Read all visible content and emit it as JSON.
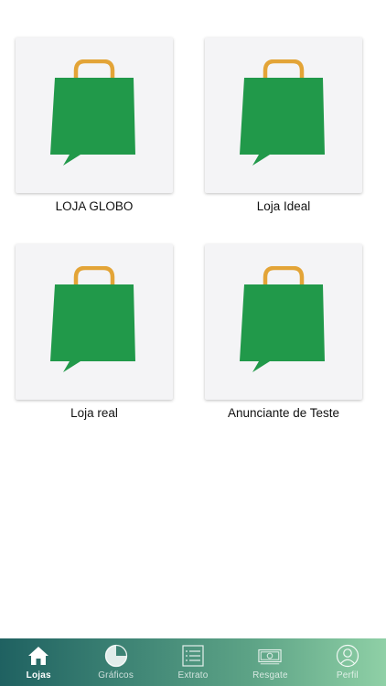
{
  "stores": [
    {
      "name": "LOJA GLOBO",
      "icon": "shopping-bag-chat-icon"
    },
    {
      "name": "Loja Ideal",
      "icon": "shopping-bag-chat-icon"
    },
    {
      "name": "Loja real",
      "icon": "shopping-bag-chat-icon"
    },
    {
      "name": "Anunciante de Teste",
      "icon": "shopping-bag-chat-icon"
    }
  ],
  "tabbar": {
    "active": "Lojas",
    "tabs": [
      {
        "label": "Lojas",
        "icon": "home-icon"
      },
      {
        "label": "Gráficos",
        "icon": "pie-chart-icon"
      },
      {
        "label": "Extrato",
        "icon": "list-icon"
      },
      {
        "label": "Resgate",
        "icon": "cash-icon"
      },
      {
        "label": "Perfil",
        "icon": "user-icon"
      }
    ]
  },
  "colors": {
    "bag_green": "#21994a",
    "bag_handle": "#e3a437",
    "card_bg": "#f4f4f6",
    "tabbar_start": "#1f6161",
    "tabbar_end": "#8fd0a6"
  }
}
